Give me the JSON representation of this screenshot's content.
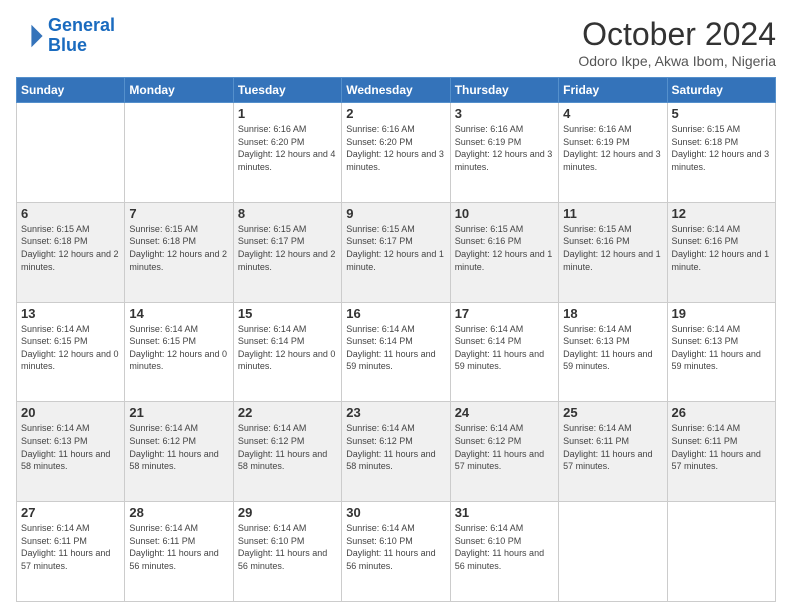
{
  "logo": {
    "line1": "General",
    "line2": "Blue"
  },
  "title": "October 2024",
  "location": "Odoro Ikpe, Akwa Ibom, Nigeria",
  "headers": [
    "Sunday",
    "Monday",
    "Tuesday",
    "Wednesday",
    "Thursday",
    "Friday",
    "Saturday"
  ],
  "weeks": [
    [
      {
        "day": "",
        "sunrise": "",
        "sunset": "",
        "daylight": ""
      },
      {
        "day": "",
        "sunrise": "",
        "sunset": "",
        "daylight": ""
      },
      {
        "day": "1",
        "sunrise": "Sunrise: 6:16 AM",
        "sunset": "Sunset: 6:20 PM",
        "daylight": "Daylight: 12 hours and 4 minutes."
      },
      {
        "day": "2",
        "sunrise": "Sunrise: 6:16 AM",
        "sunset": "Sunset: 6:20 PM",
        "daylight": "Daylight: 12 hours and 3 minutes."
      },
      {
        "day": "3",
        "sunrise": "Sunrise: 6:16 AM",
        "sunset": "Sunset: 6:19 PM",
        "daylight": "Daylight: 12 hours and 3 minutes."
      },
      {
        "day": "4",
        "sunrise": "Sunrise: 6:16 AM",
        "sunset": "Sunset: 6:19 PM",
        "daylight": "Daylight: 12 hours and 3 minutes."
      },
      {
        "day": "5",
        "sunrise": "Sunrise: 6:15 AM",
        "sunset": "Sunset: 6:18 PM",
        "daylight": "Daylight: 12 hours and 3 minutes."
      }
    ],
    [
      {
        "day": "6",
        "sunrise": "Sunrise: 6:15 AM",
        "sunset": "Sunset: 6:18 PM",
        "daylight": "Daylight: 12 hours and 2 minutes."
      },
      {
        "day": "7",
        "sunrise": "Sunrise: 6:15 AM",
        "sunset": "Sunset: 6:18 PM",
        "daylight": "Daylight: 12 hours and 2 minutes."
      },
      {
        "day": "8",
        "sunrise": "Sunrise: 6:15 AM",
        "sunset": "Sunset: 6:17 PM",
        "daylight": "Daylight: 12 hours and 2 minutes."
      },
      {
        "day": "9",
        "sunrise": "Sunrise: 6:15 AM",
        "sunset": "Sunset: 6:17 PM",
        "daylight": "Daylight: 12 hours and 1 minute."
      },
      {
        "day": "10",
        "sunrise": "Sunrise: 6:15 AM",
        "sunset": "Sunset: 6:16 PM",
        "daylight": "Daylight: 12 hours and 1 minute."
      },
      {
        "day": "11",
        "sunrise": "Sunrise: 6:15 AM",
        "sunset": "Sunset: 6:16 PM",
        "daylight": "Daylight: 12 hours and 1 minute."
      },
      {
        "day": "12",
        "sunrise": "Sunrise: 6:14 AM",
        "sunset": "Sunset: 6:16 PM",
        "daylight": "Daylight: 12 hours and 1 minute."
      }
    ],
    [
      {
        "day": "13",
        "sunrise": "Sunrise: 6:14 AM",
        "sunset": "Sunset: 6:15 PM",
        "daylight": "Daylight: 12 hours and 0 minutes."
      },
      {
        "day": "14",
        "sunrise": "Sunrise: 6:14 AM",
        "sunset": "Sunset: 6:15 PM",
        "daylight": "Daylight: 12 hours and 0 minutes."
      },
      {
        "day": "15",
        "sunrise": "Sunrise: 6:14 AM",
        "sunset": "Sunset: 6:14 PM",
        "daylight": "Daylight: 12 hours and 0 minutes."
      },
      {
        "day": "16",
        "sunrise": "Sunrise: 6:14 AM",
        "sunset": "Sunset: 6:14 PM",
        "daylight": "Daylight: 11 hours and 59 minutes."
      },
      {
        "day": "17",
        "sunrise": "Sunrise: 6:14 AM",
        "sunset": "Sunset: 6:14 PM",
        "daylight": "Daylight: 11 hours and 59 minutes."
      },
      {
        "day": "18",
        "sunrise": "Sunrise: 6:14 AM",
        "sunset": "Sunset: 6:13 PM",
        "daylight": "Daylight: 11 hours and 59 minutes."
      },
      {
        "day": "19",
        "sunrise": "Sunrise: 6:14 AM",
        "sunset": "Sunset: 6:13 PM",
        "daylight": "Daylight: 11 hours and 59 minutes."
      }
    ],
    [
      {
        "day": "20",
        "sunrise": "Sunrise: 6:14 AM",
        "sunset": "Sunset: 6:13 PM",
        "daylight": "Daylight: 11 hours and 58 minutes."
      },
      {
        "day": "21",
        "sunrise": "Sunrise: 6:14 AM",
        "sunset": "Sunset: 6:12 PM",
        "daylight": "Daylight: 11 hours and 58 minutes."
      },
      {
        "day": "22",
        "sunrise": "Sunrise: 6:14 AM",
        "sunset": "Sunset: 6:12 PM",
        "daylight": "Daylight: 11 hours and 58 minutes."
      },
      {
        "day": "23",
        "sunrise": "Sunrise: 6:14 AM",
        "sunset": "Sunset: 6:12 PM",
        "daylight": "Daylight: 11 hours and 58 minutes."
      },
      {
        "day": "24",
        "sunrise": "Sunrise: 6:14 AM",
        "sunset": "Sunset: 6:12 PM",
        "daylight": "Daylight: 11 hours and 57 minutes."
      },
      {
        "day": "25",
        "sunrise": "Sunrise: 6:14 AM",
        "sunset": "Sunset: 6:11 PM",
        "daylight": "Daylight: 11 hours and 57 minutes."
      },
      {
        "day": "26",
        "sunrise": "Sunrise: 6:14 AM",
        "sunset": "Sunset: 6:11 PM",
        "daylight": "Daylight: 11 hours and 57 minutes."
      }
    ],
    [
      {
        "day": "27",
        "sunrise": "Sunrise: 6:14 AM",
        "sunset": "Sunset: 6:11 PM",
        "daylight": "Daylight: 11 hours and 57 minutes."
      },
      {
        "day": "28",
        "sunrise": "Sunrise: 6:14 AM",
        "sunset": "Sunset: 6:11 PM",
        "daylight": "Daylight: 11 hours and 56 minutes."
      },
      {
        "day": "29",
        "sunrise": "Sunrise: 6:14 AM",
        "sunset": "Sunset: 6:10 PM",
        "daylight": "Daylight: 11 hours and 56 minutes."
      },
      {
        "day": "30",
        "sunrise": "Sunrise: 6:14 AM",
        "sunset": "Sunset: 6:10 PM",
        "daylight": "Daylight: 11 hours and 56 minutes."
      },
      {
        "day": "31",
        "sunrise": "Sunrise: 6:14 AM",
        "sunset": "Sunset: 6:10 PM",
        "daylight": "Daylight: 11 hours and 56 minutes."
      },
      {
        "day": "",
        "sunrise": "",
        "sunset": "",
        "daylight": ""
      },
      {
        "day": "",
        "sunrise": "",
        "sunset": "",
        "daylight": ""
      }
    ]
  ],
  "colors": {
    "header_bg": "#3473ba",
    "row_shaded": "#f0f0f0",
    "row_white": "#ffffff"
  }
}
